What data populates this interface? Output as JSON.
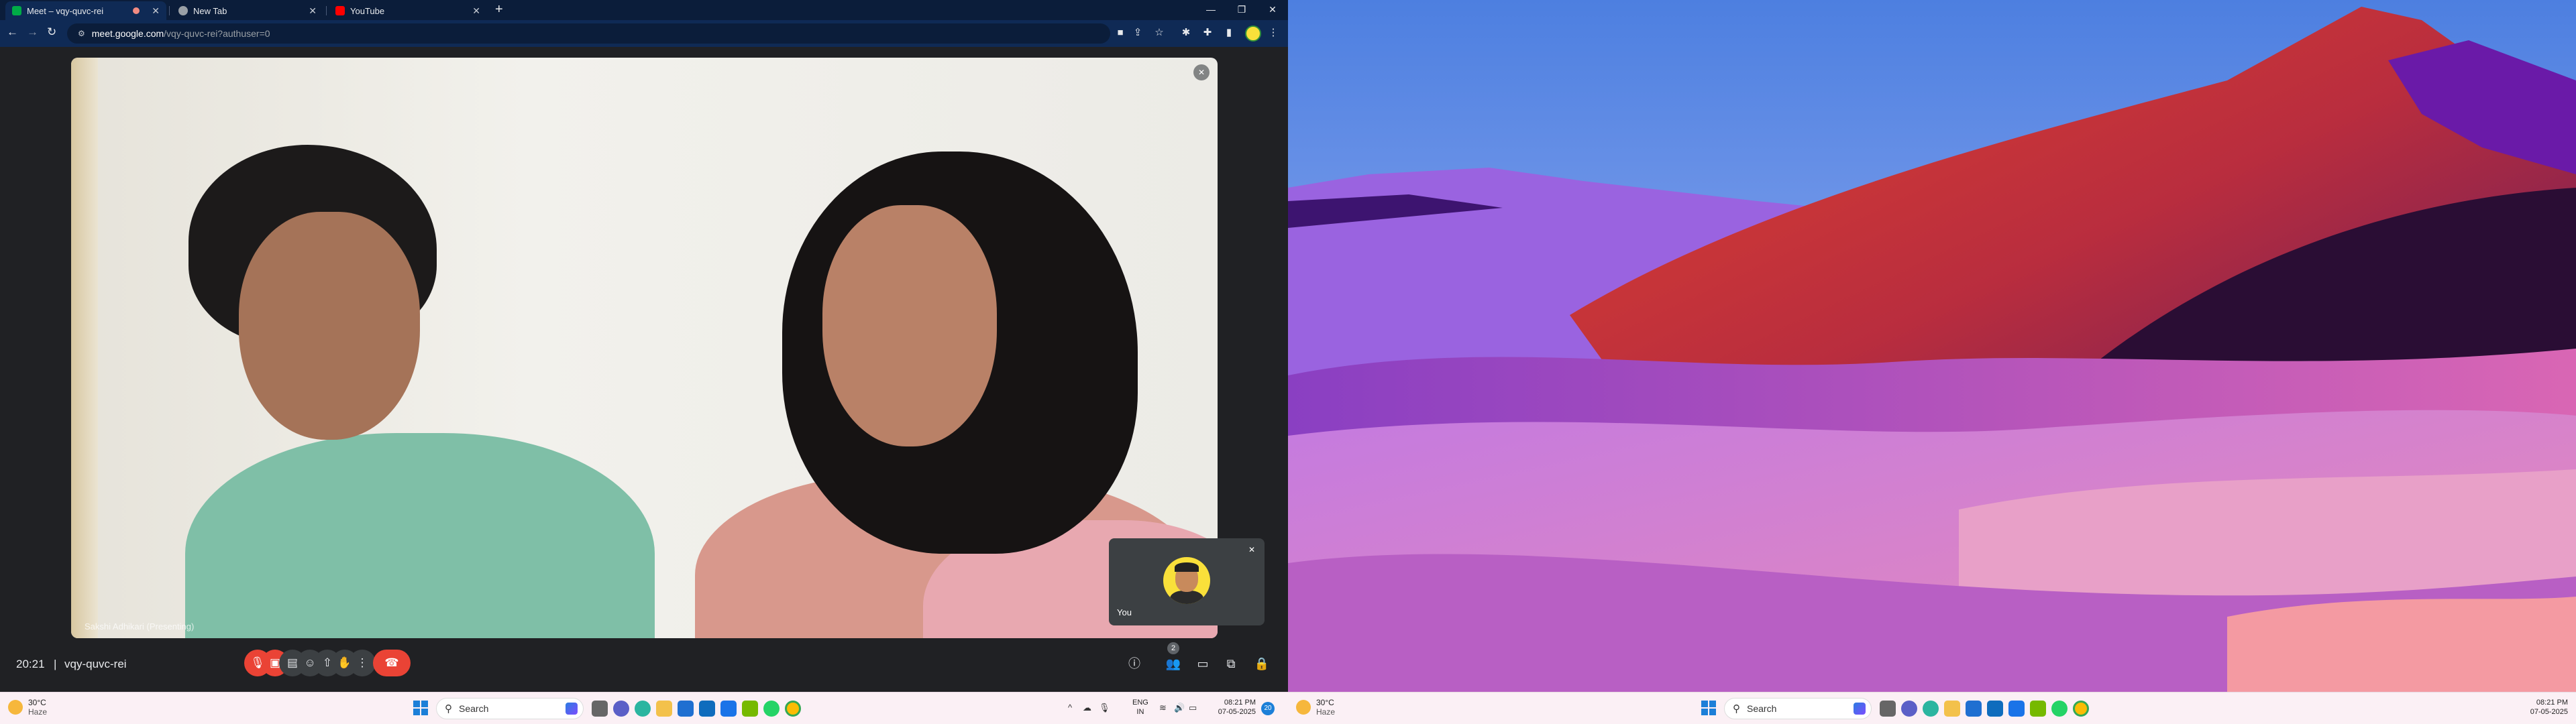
{
  "browser": {
    "tabs": [
      {
        "title": "Meet – vqy-quvc-rei"
      },
      {
        "title": "New Tab"
      },
      {
        "title": "YouTube"
      }
    ],
    "new_tab_label": "+",
    "window_controls": {
      "minimize": "—",
      "maximize": "❐",
      "close": "✕"
    },
    "address": {
      "host": "meet.google.com",
      "path": "/vqy-quvc-rei?authuser=0"
    }
  },
  "meet": {
    "participant_tag": "Sakshi Adhikari (Presenting)",
    "self_label": "You",
    "time": "20:21",
    "separator": "|",
    "meeting_code": "vqy-quvc-rei",
    "participant_count": "2"
  },
  "taskbar": {
    "weather_temp": "30°C",
    "weather_desc": "Haze",
    "search_placeholder": "Search",
    "lang_top": "ENG",
    "lang_bottom": "IN",
    "time": "08:21 PM",
    "date": "07-05-2025",
    "notification_count": "20"
  },
  "taskbar_right": {
    "weather_temp": "30°C",
    "weather_desc": "Haze",
    "search_placeholder": "Search",
    "time": "08:21 PM",
    "date": "07-05-2025"
  },
  "colors": {
    "chrome_dark": "#0b1d3a",
    "meet_bg": "#202124",
    "end_call_red": "#ea4335",
    "taskbar_bg": "#fbf0f5"
  }
}
